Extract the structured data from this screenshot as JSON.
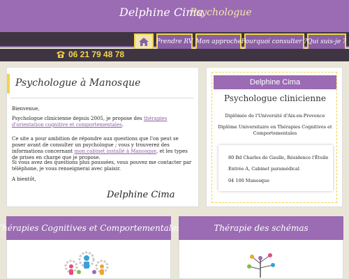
{
  "header": {
    "name": "Delphine Cima",
    "tagline": "Psychologue",
    "phone": "06 21 79 48 78"
  },
  "nav": {
    "home_icon": "home-icon",
    "items": [
      {
        "label": "Prendre RV"
      },
      {
        "label": "Mon approche"
      },
      {
        "label": "Pourquoi consulter ?"
      },
      {
        "label": "Qui suis-je ?"
      }
    ]
  },
  "intro": {
    "title": "Psychologue à Manosque",
    "greeting": "Bienvenue,",
    "p2_before": "Psychologue clinicienne depuis 2005, je propose des ",
    "p2_link": "thérapies d'orientation cognitive et comportementales",
    "p2_after": ".",
    "p3_before": "Ce site a pour ambition de répondre aux questions que l'on peut se poser avant de consulter un psychologue ; vous y trouverez des informations concernant ",
    "p3_link": "mon cabinet installé à Manosque",
    "p3_after": ", et les types de prises en charge que je propose.",
    "p4": "Si vous avez des questions plus poussées, vous pouvez me contacter par téléphone, je vous renseignerai avec plaisir.",
    "p5": "A bientôt,",
    "signature": "Delphine Cima"
  },
  "info": {
    "name": "Delphine Cima",
    "title": "Psychologue clinicienne",
    "diploma1": "Diplômée de l'Université d'Aix-en-Provence",
    "diploma2": "Diplôme Universitaire en Thérapies Cognitives et Comportementales",
    "address1": "80 Bd Charles de Gaulle, Résidence l'Étoile",
    "address2": "Entrée A, Cabinet paramédical",
    "address3": "04 100 Manosque"
  },
  "cards": {
    "tcc_title": "Thérapies Cognitives et Comportementales",
    "schema_title": "Thérapie des schémas"
  },
  "colors": {
    "purple": "#9b6bb3",
    "nav_purple": "#8a5fa4",
    "gold": "#f3d44a",
    "dark": "#3f3542",
    "background": "#e9e6d8"
  }
}
